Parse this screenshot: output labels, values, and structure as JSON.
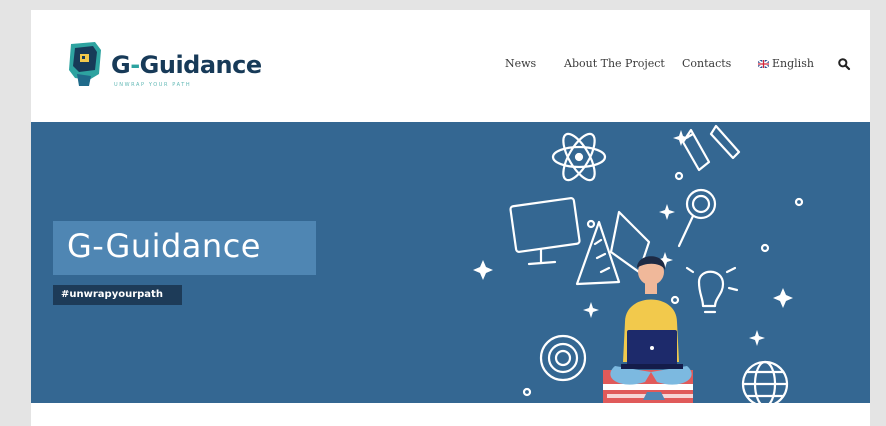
{
  "brand": {
    "name_part1": "G",
    "name_dash": "-",
    "name_part2": "Guidance",
    "tagline": "UNWRAP YOUR PATH"
  },
  "nav": {
    "items": [
      "News",
      "About The Project",
      "Contacts"
    ],
    "language": "English",
    "search_icon": "search-icon"
  },
  "hero": {
    "title": "G-Guidance",
    "hashtag": "#unwrapyourpath"
  },
  "colors": {
    "hero_bg": "#346792",
    "title_box": "#4f86b3",
    "hashtag_box": "#1d3b58",
    "brand_dark": "#173a58",
    "brand_teal": "#2da3a0",
    "accent_yellow": "#f2c94c"
  }
}
